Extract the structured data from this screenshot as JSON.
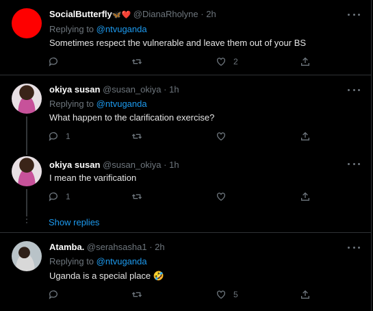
{
  "tweets": [
    {
      "name": "SocialButterfly",
      "name_emoji": "🦋❤️",
      "handle": "@DianaRholyne",
      "time": "2h",
      "replying_label": "Replying to",
      "replying_to": "@ntvuganda",
      "text": "Sometimes respect the vulnerable and leave them out of your BS",
      "reply_count": "",
      "retweet_count": "",
      "like_count": "2"
    },
    {
      "name": "okiya susan",
      "handle": "@susan_okiya",
      "time": "1h",
      "replying_label": "Replying to",
      "replying_to": "@ntvuganda",
      "text": "What happen to the clarification exercise?",
      "reply_count": "1",
      "retweet_count": "",
      "like_count": ""
    },
    {
      "name": "okiya susan",
      "handle": "@susan_okiya",
      "time": "1h",
      "text": "I mean the varification",
      "reply_count": "1",
      "retweet_count": "",
      "like_count": ""
    },
    {
      "name": "Atamba.",
      "handle": "@serahsasha1",
      "time": "2h",
      "replying_label": "Replying to",
      "replying_to": "@ntvuganda",
      "text": "Uganda is a special place",
      "text_emoji": "🤣",
      "reply_count": "",
      "retweet_count": "",
      "like_count": "5"
    }
  ],
  "show_replies_label": "Show replies",
  "separator": "·",
  "colors": {
    "accent": "#1d9bf0",
    "muted": "#6e767d",
    "background": "#000000",
    "divider": "#2f3336"
  },
  "icons": [
    "reply-icon",
    "retweet-icon",
    "like-icon",
    "share-icon",
    "more-icon"
  ]
}
